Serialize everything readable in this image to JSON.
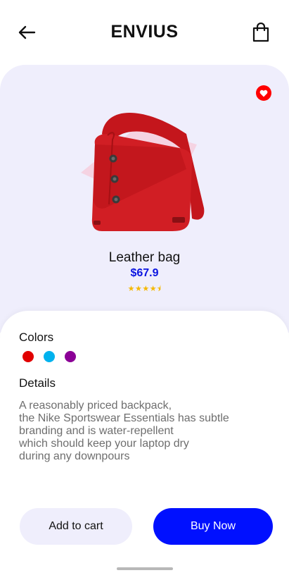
{
  "header": {
    "brand": "ENVIUS",
    "back_icon": "arrow-left-icon",
    "bag_icon": "shopping-bag-icon"
  },
  "product": {
    "name": "Leather bag",
    "price": "$67.9",
    "rating": 4.5,
    "rating_stars": "★★★★⯨",
    "favorite": true,
    "accent": "#0a14e0"
  },
  "colors": {
    "title": "Colors",
    "options": [
      "#e10000",
      "#00b2ee",
      "#8b0096"
    ]
  },
  "details": {
    "title": "Details",
    "text": "A reasonably priced backpack,\nthe Nike Sportswear Essentials has subtle\nbranding and is water-repellent\nwhich should keep your laptop dry\nduring any downpours"
  },
  "actions": {
    "add_to_cart": "Add to cart",
    "buy_now": "Buy Now"
  }
}
